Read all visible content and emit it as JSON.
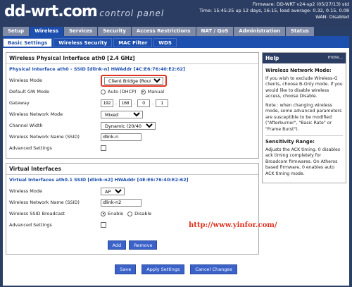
{
  "header": {
    "logo": "dd-wrt.com",
    "subtitle": "... control panel",
    "info_line1": "Firmware: DD-WRT v24-sp2 (05/27/13) std",
    "info_line2": "Time: 15:45:25 up 12 days, 16:15, load average: 0.32, 0.15, 0.08",
    "info_line3": "WAN: Disabled"
  },
  "main_tabs": [
    "Setup",
    "Wireless",
    "Services",
    "Security",
    "Access Restrictions",
    "NAT / QoS",
    "Administration",
    "Status"
  ],
  "sub_tabs": [
    "Basic Settings",
    "Wireless Security",
    "MAC Filter",
    "WDS"
  ],
  "section1": {
    "title": "Wireless Physical Interface ath0 [2.4 GHz]",
    "iface_title": "Physical Interface ath0 - SSID [dlink-n] HWAddr [4C:E6:76:40:E2:62]",
    "wireless_mode_label": "Wireless Mode",
    "wireless_mode_value": "Client Bridge (Routed)",
    "gw_mode_label": "Default GW Mode",
    "gw_opt_auto": "Auto (DHCP)",
    "gw_opt_manual": "Manual",
    "gateway_label": "Gateway",
    "gateway_octets": [
      "192",
      "168",
      "0",
      "1"
    ],
    "net_mode_label": "Wireless Network Mode",
    "net_mode_value": "Mixed",
    "chan_width_label": "Channel Width",
    "chan_width_value": "Dynamic (20/40 MHz)",
    "ssid_label": "Wireless Network Name (SSID)",
    "ssid_value": "dlink-n",
    "adv_label": "Advanced Settings"
  },
  "section2": {
    "title": "Virtual Interfaces",
    "iface_title": "Virtual Interfaces ath0.1 SSID [dlink-n2] HWAddr [4E:E6:76:40:E2:62]",
    "wireless_mode_label": "Wireless Mode",
    "wireless_mode_value": "AP",
    "ssid_label": "Wireless Network Name (SSID)",
    "ssid_value": "dlink-n2",
    "broadcast_label": "Wireless SSID Broadcast",
    "opt_enable": "Enable",
    "opt_disable": "Disable",
    "adv_label": "Advanced Settings",
    "add_btn": "Add",
    "remove_btn": "Remove"
  },
  "help": {
    "title": "Help",
    "more": "more...",
    "h1": "Wireless Network Mode:",
    "p1": "If you wish to exclude Wireless-G clients, choose B-Only mode. If you would like to disable wireless access, choose Disable.",
    "p2": "Note : when changing wireless mode, some advanced parameters are susceptible to be modified (\"Afterburner\", \"Basic Rate\" or \"Frame Burst\").",
    "h2": "Sensitivity Range:",
    "p3": "Adjusts the ACK timing. 0 disables ack timing completely for Broadcom firmwares. On Atheros based firmware, 0 enables auto ACK timing mode."
  },
  "watermark": "http://www.yinfor.com/",
  "bottom": {
    "save": "Save",
    "apply": "Apply Settings",
    "cancel": "Cancel Changes"
  }
}
